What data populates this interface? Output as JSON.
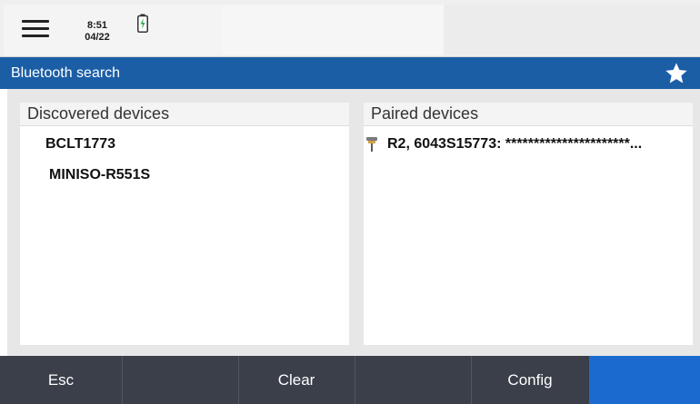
{
  "status": {
    "time": "8:51",
    "date": "04/22",
    "icons": [
      "menu-icon",
      "battery-charging-icon"
    ]
  },
  "title": {
    "text": "Bluetooth search",
    "star_icon": "star-icon"
  },
  "discovered": {
    "header": "Discovered devices",
    "items": [
      "BCLT1773",
      "MINISO-R551S"
    ]
  },
  "paired": {
    "header": "Paired devices",
    "items": [
      {
        "icon": "gnss-receiver-icon",
        "label": "R2, 6043S15773: **********************..."
      }
    ]
  },
  "bottom": {
    "buttons": [
      "Esc",
      "",
      "Clear",
      "",
      "Config",
      ""
    ]
  },
  "colors": {
    "title_bar": "#1b5ea6",
    "bottom_bar": "#3a3f4a",
    "highlight_button": "#1b6ad0"
  }
}
